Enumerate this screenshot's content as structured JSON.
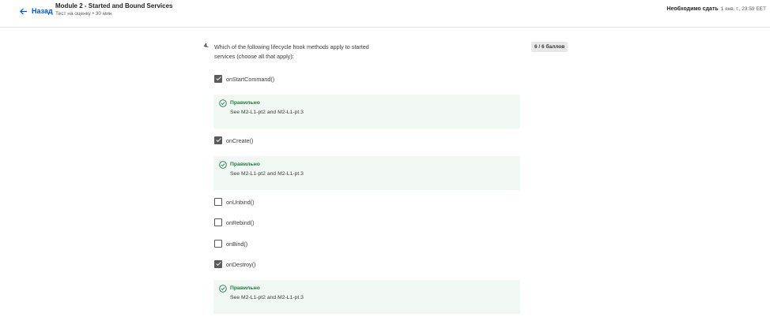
{
  "header": {
    "back_label": "Назад",
    "title": "Module 2 - Started and Bound Services",
    "subtitle": "Тест на оценку • 30 мин",
    "due_label": "Необходимо сдать",
    "due_date": "1 янв. г., 23:59 EET"
  },
  "question": {
    "number": "4.",
    "text": "Which of the following lifecycle hook methods apply to started services (choose all that apply):",
    "points": "6 / 6 баллов",
    "options": [
      {
        "label": "onStartCommand()",
        "checked": true
      },
      {
        "label": "onCreate()",
        "checked": true
      },
      {
        "label": "onUnbind()",
        "checked": false
      },
      {
        "label": "onRebind()",
        "checked": false
      },
      {
        "label": "onBind()",
        "checked": false
      },
      {
        "label": "onDestroy()",
        "checked": true
      }
    ],
    "feedback": [
      {
        "title": "Правильно",
        "note": "See M2-L1-pt2 and M2-L1-pt.3"
      },
      {
        "title": "Правильно",
        "note": "See M2-L1-pt2 and M2-L1-pt.3"
      },
      {
        "title": "Правильно",
        "note": "See M2-L1-pt2 and M2-L1-pt.3"
      }
    ]
  },
  "colors": {
    "accent": "#0056d2",
    "correct": "#1e7a3e",
    "feedback_bg": "#f1f8f4"
  }
}
